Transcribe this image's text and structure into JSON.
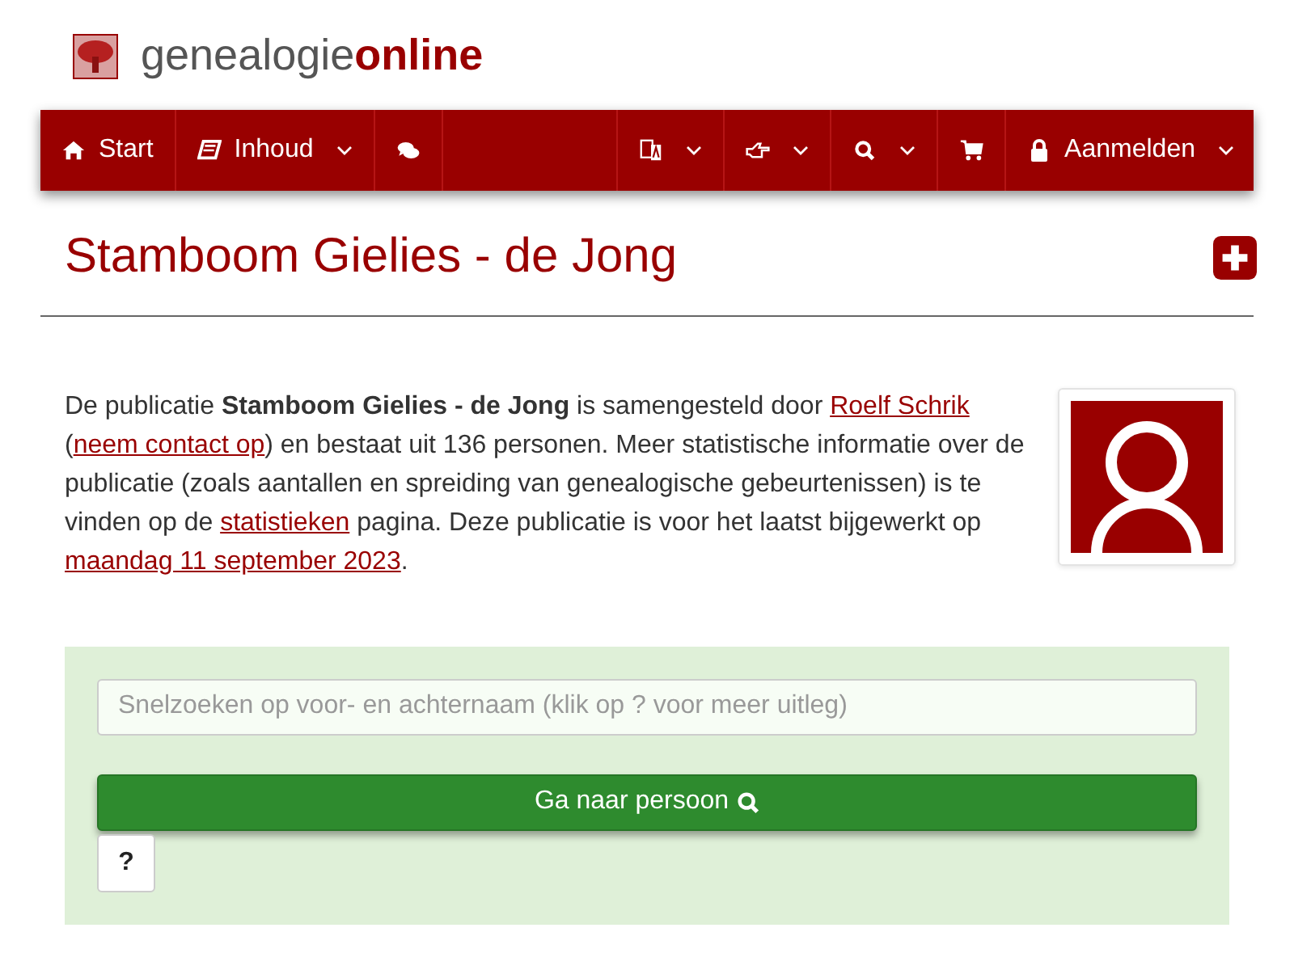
{
  "logo": {
    "light": "genealogie",
    "bold": "online"
  },
  "nav": [
    {
      "label": "Start",
      "dropdown": false
    },
    {
      "label": "Inhoud",
      "dropdown": true
    },
    {
      "dropdown": false
    },
    {
      "kind": "spacer"
    },
    {
      "dropdown": true
    },
    {
      "dropdown": true
    },
    {
      "dropdown": true
    },
    {
      "dropdown": false
    },
    {
      "label": "Aanmelden",
      "dropdown": true
    }
  ],
  "title": "Stamboom Gielies - de Jong",
  "intro": [
    {
      "kind": "text",
      "text": "De publicatie **Stamboom Gielies - de Jong** is samengesteld door "
    },
    {
      "kind": "link",
      "text": "Roelf Schrik"
    },
    {
      "kind": "text",
      "text": " ("
    },
    {
      "kind": "link",
      "text": "neem contact op"
    },
    {
      "kind": "text",
      "text": ") en bestaat uit 136 personen. Meer statistische informatie over de publicatie (zoals aantallen en spreiding van genealogische gebeurtenissen) is te vinden op de "
    },
    {
      "kind": "link",
      "text": "statistieken"
    },
    {
      "kind": "text",
      "text": " pagina. Deze publicatie is voor het laatst bijgewerkt op "
    },
    {
      "kind": "link",
      "text": "maandag 11 september 2023"
    },
    {
      "kind": "text",
      "text": "."
    }
  ],
  "search": {
    "placeholder": "Snelzoeken op voor- en achternaam (klik op ? voor meer uitleg)",
    "button": "Ga naar persoon",
    "help": "?"
  }
}
